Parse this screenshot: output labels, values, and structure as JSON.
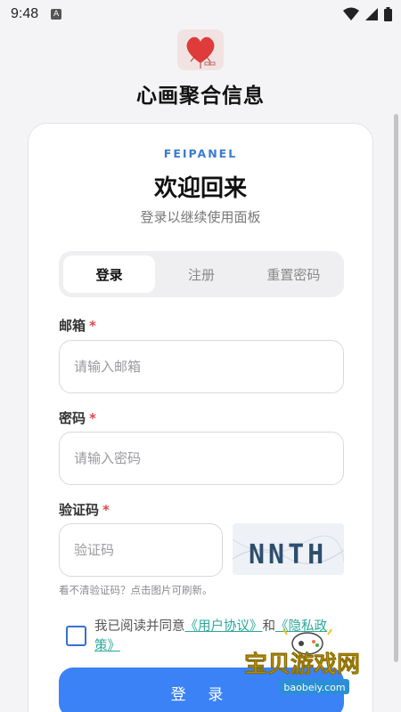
{
  "status_bar": {
    "time": "9:48",
    "notification_icon": "A"
  },
  "app": {
    "title": "心画聚合信息"
  },
  "card": {
    "brand": "FEIPANEL",
    "welcome": "欢迎回来",
    "subtitle": "登录以继续使用面板"
  },
  "tabs": [
    {
      "label": "登录",
      "active": true
    },
    {
      "label": "注册",
      "active": false
    },
    {
      "label": "重置密码",
      "active": false
    }
  ],
  "email": {
    "label": "邮箱",
    "required": "*",
    "placeholder": "请输入邮箱",
    "value": ""
  },
  "password": {
    "label": "密码",
    "required": "*",
    "placeholder": "请输入密码",
    "value": ""
  },
  "captcha": {
    "label": "验证码",
    "required": "*",
    "placeholder": "验证码",
    "value": "",
    "image_text": "NNTH",
    "hint": "看不清验证码？点击图片可刷新。"
  },
  "agreement": {
    "checked": false,
    "prefix": "我已阅读并同意",
    "user_agreement": "《用户协议》",
    "and": "和",
    "privacy_policy_part1": "《隐私政",
    "privacy_policy_part2": "策》"
  },
  "login_button": {
    "label": "登 录"
  },
  "watermark": {
    "text": "宝贝游戏网",
    "url": "baobeiy.com"
  },
  "colors": {
    "accent": "#3b82f6",
    "brand": "#3a7bd5",
    "link": "#2aa79a",
    "required": "#e04848"
  }
}
